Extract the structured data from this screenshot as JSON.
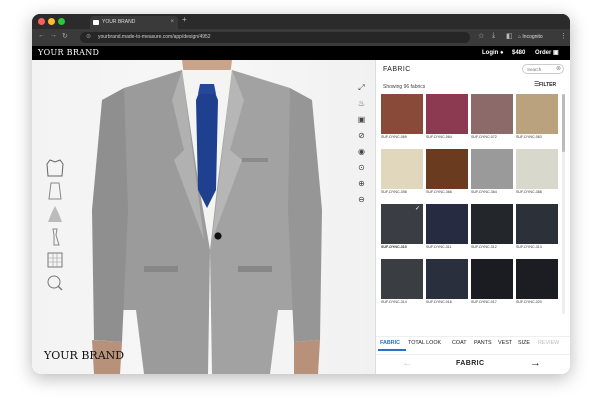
{
  "browser": {
    "tab_title": "YOUR BRAND",
    "new_tab": "+",
    "url": "yourbrand.made-to-measure.com/app/design/4952",
    "incognito_label": "Incognito"
  },
  "header": {
    "brand": "YOUR BRAND",
    "login": "Login",
    "price": "$480",
    "order": "Order"
  },
  "model": {
    "brand_watermark": "YOUR BRAND",
    "tools": [
      "fullscreen-icon",
      "flame-icon",
      "save-icon",
      "hide-icon",
      "eye-icon",
      "zoom-detail-icon",
      "zoom-in-icon",
      "zoom-out-icon"
    ],
    "parts": [
      "jacket-part",
      "shirt-part",
      "body-part",
      "tie-part",
      "fabric-part",
      "detail-part"
    ]
  },
  "panel": {
    "title": "FABRIC",
    "search_placeholder": "Search",
    "showing": "Showing 96 fabrics",
    "filter": "FILTER",
    "fabrics": [
      {
        "label": "SUF-DYNC-069",
        "color": "#8a4a3a"
      },
      {
        "label": "SUF-DYNC-064",
        "color": "#8b3a52"
      },
      {
        "label": "SUF-DYNC-072",
        "color": "#8c6a6a"
      },
      {
        "label": "SUF-DYNC-063",
        "color": "#bba27f"
      },
      {
        "label": "SUF-DYNC-398",
        "color": "#e0d7bd"
      },
      {
        "label": "SUF-DYNC-366",
        "color": "#6a3b1e"
      },
      {
        "label": "SUF-DYNC-364",
        "color": "#9a9a9a"
      },
      {
        "label": "SUF-DYNC-368",
        "color": "#d9d8cc"
      },
      {
        "label": "SUF-DYNC-310",
        "color": "#3a3d44"
      },
      {
        "label": "SUF-DYNC-311",
        "color": "#262b42"
      },
      {
        "label": "SUF-DYNC-312",
        "color": "#23262b"
      },
      {
        "label": "SUF-DYNC-313",
        "color": "#2c3038"
      },
      {
        "label": "SUF-DYNC-314",
        "color": "#3a3d42"
      },
      {
        "label": "SUF-DYNC-016",
        "color": "#2a2f3d"
      },
      {
        "label": "SUF-DYNC-017",
        "color": "#1a1c22"
      },
      {
        "label": "SUF-DYNC-020",
        "color": "#1c1d22"
      }
    ],
    "selected_index": 8,
    "tabs": [
      "FABRIC",
      "TOTAL LOOK",
      "COAT",
      "PANTS",
      "VEST",
      "SIZE",
      "REVIEW"
    ],
    "active_tab": "FABRIC",
    "nav_label": "FABRIC"
  }
}
